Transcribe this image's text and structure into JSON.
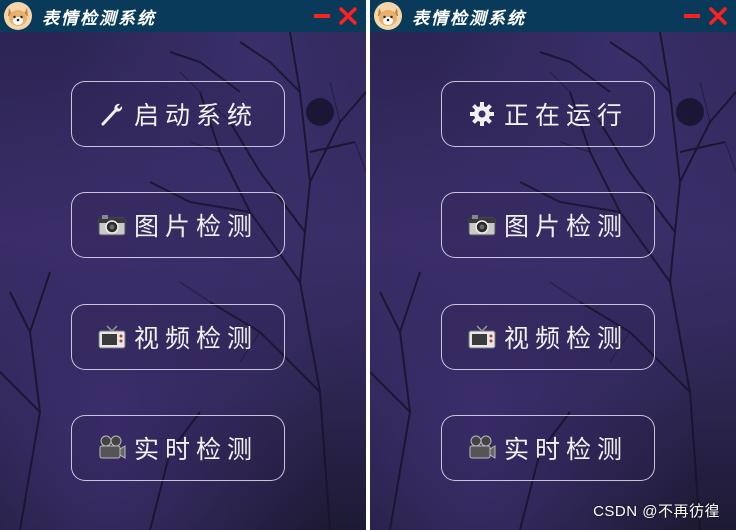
{
  "windows": [
    {
      "title": "表情检测系统",
      "buttons": [
        {
          "label": "启动系统",
          "icon": "wrench-icon"
        },
        {
          "label": "图片检测",
          "icon": "camera-icon"
        },
        {
          "label": "视频检测",
          "icon": "tv-icon"
        },
        {
          "label": "实时检测",
          "icon": "video-camera-icon"
        }
      ]
    },
    {
      "title": "表情检测系统",
      "buttons": [
        {
          "label": "正在运行",
          "icon": "gear-icon"
        },
        {
          "label": "图片检测",
          "icon": "camera-icon"
        },
        {
          "label": "视频检测",
          "icon": "tv-icon"
        },
        {
          "label": "实时检测",
          "icon": "video-camera-icon"
        }
      ]
    }
  ],
  "watermark": "CSDN @不再彷徨",
  "colors": {
    "titlebar": "#0a3a5a",
    "window_controls": "#ff1f1f",
    "button_border": "#e6e1f0",
    "background": "#2f2758"
  }
}
